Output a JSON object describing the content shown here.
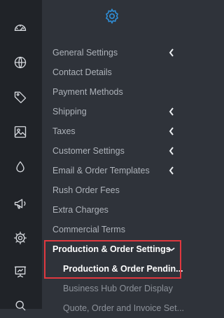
{
  "rail": {
    "icons": [
      "dashboard-icon",
      "globe-icon",
      "tag-icon",
      "image-icon",
      "droplet-icon",
      "megaphone-icon",
      "gear-icon",
      "presentation-icon",
      "search-icon"
    ]
  },
  "panel": {
    "header_icon": "gear-icon",
    "accent_color": "#2f8fd8"
  },
  "menu": [
    {
      "label": "General Settings",
      "chevron": "left"
    },
    {
      "label": "Contact Details"
    },
    {
      "label": "Payment Methods"
    },
    {
      "label": "Shipping",
      "chevron": "left"
    },
    {
      "label": "Taxes",
      "chevron": "left"
    },
    {
      "label": "Customer Settings",
      "chevron": "left"
    },
    {
      "label": "Email & Order Templates",
      "chevron": "left"
    },
    {
      "label": "Rush Order Fees"
    },
    {
      "label": "Extra Charges"
    },
    {
      "label": "Commercial Terms"
    },
    {
      "label": "Production & Order Settings",
      "chevron": "down",
      "expanded": true
    },
    {
      "label": "Production & Order Pendin...",
      "sub": true,
      "selected": true
    },
    {
      "label": "Business Hub Order Display",
      "sub": true
    },
    {
      "label": "Quote, Order and Invoice Set...",
      "sub": true
    }
  ],
  "highlight_color": "#e0383f"
}
